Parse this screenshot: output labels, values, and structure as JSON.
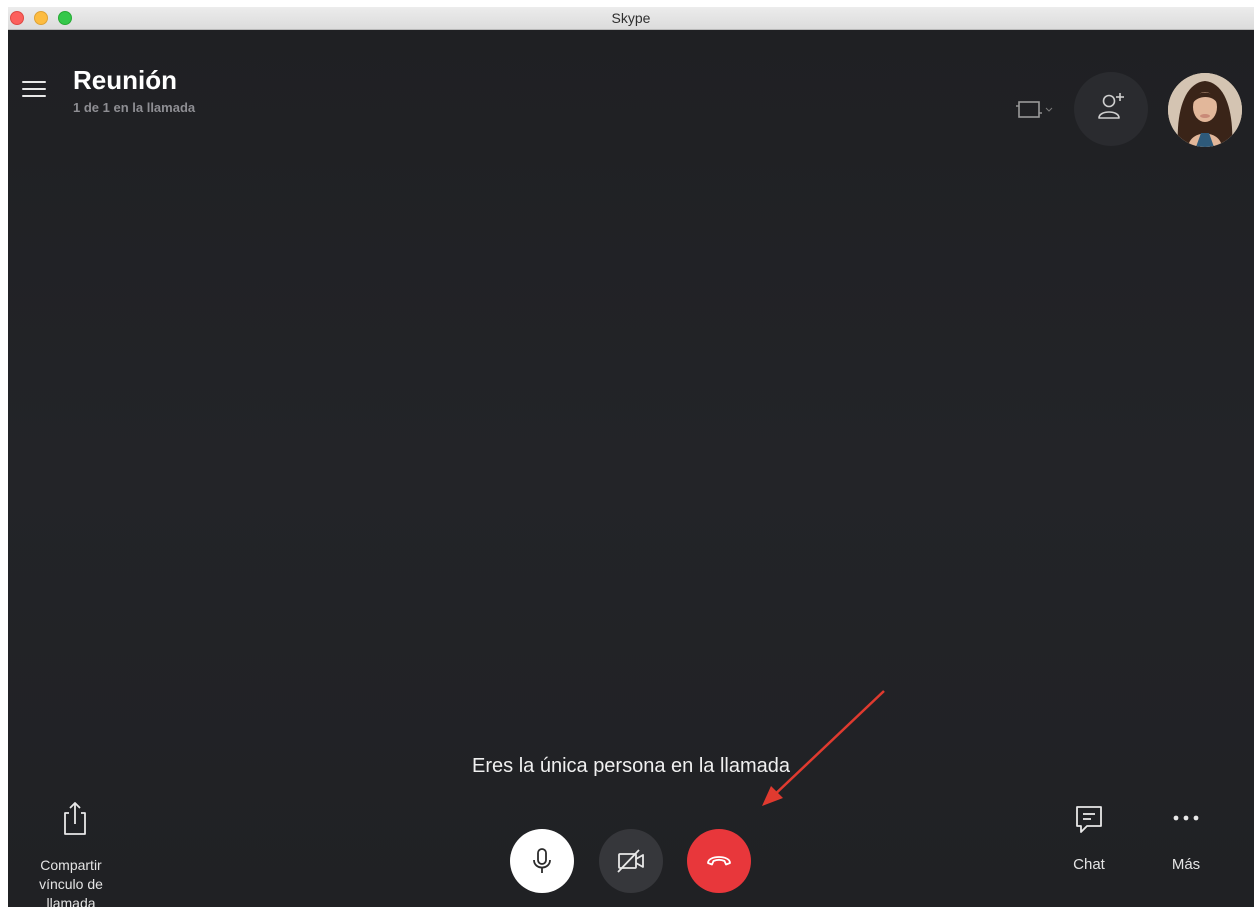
{
  "window": {
    "title": "Skype"
  },
  "header": {
    "title": "Reunión",
    "subtitle": "1 de 1 en la llamada",
    "menu_icon": "hamburger-menu-icon",
    "layout_icon": "screen-layout-icon",
    "add_person_icon": "add-person-icon"
  },
  "call": {
    "status_text": "Eres la única persona en la llamada",
    "mic_icon": "microphone-icon",
    "video_icon": "video-off-icon",
    "hangup_icon": "hang-up-icon"
  },
  "actions": {
    "share_label": "Compartir vínculo de llamada",
    "share_icon": "share-icon",
    "chat_label": "Chat",
    "chat_icon": "chat-icon",
    "more_label": "Más",
    "more_icon": "more-dots-icon"
  },
  "colors": {
    "background": "#202123",
    "hangup": "#e8373b",
    "annotation_arrow": "#e03a2f"
  }
}
